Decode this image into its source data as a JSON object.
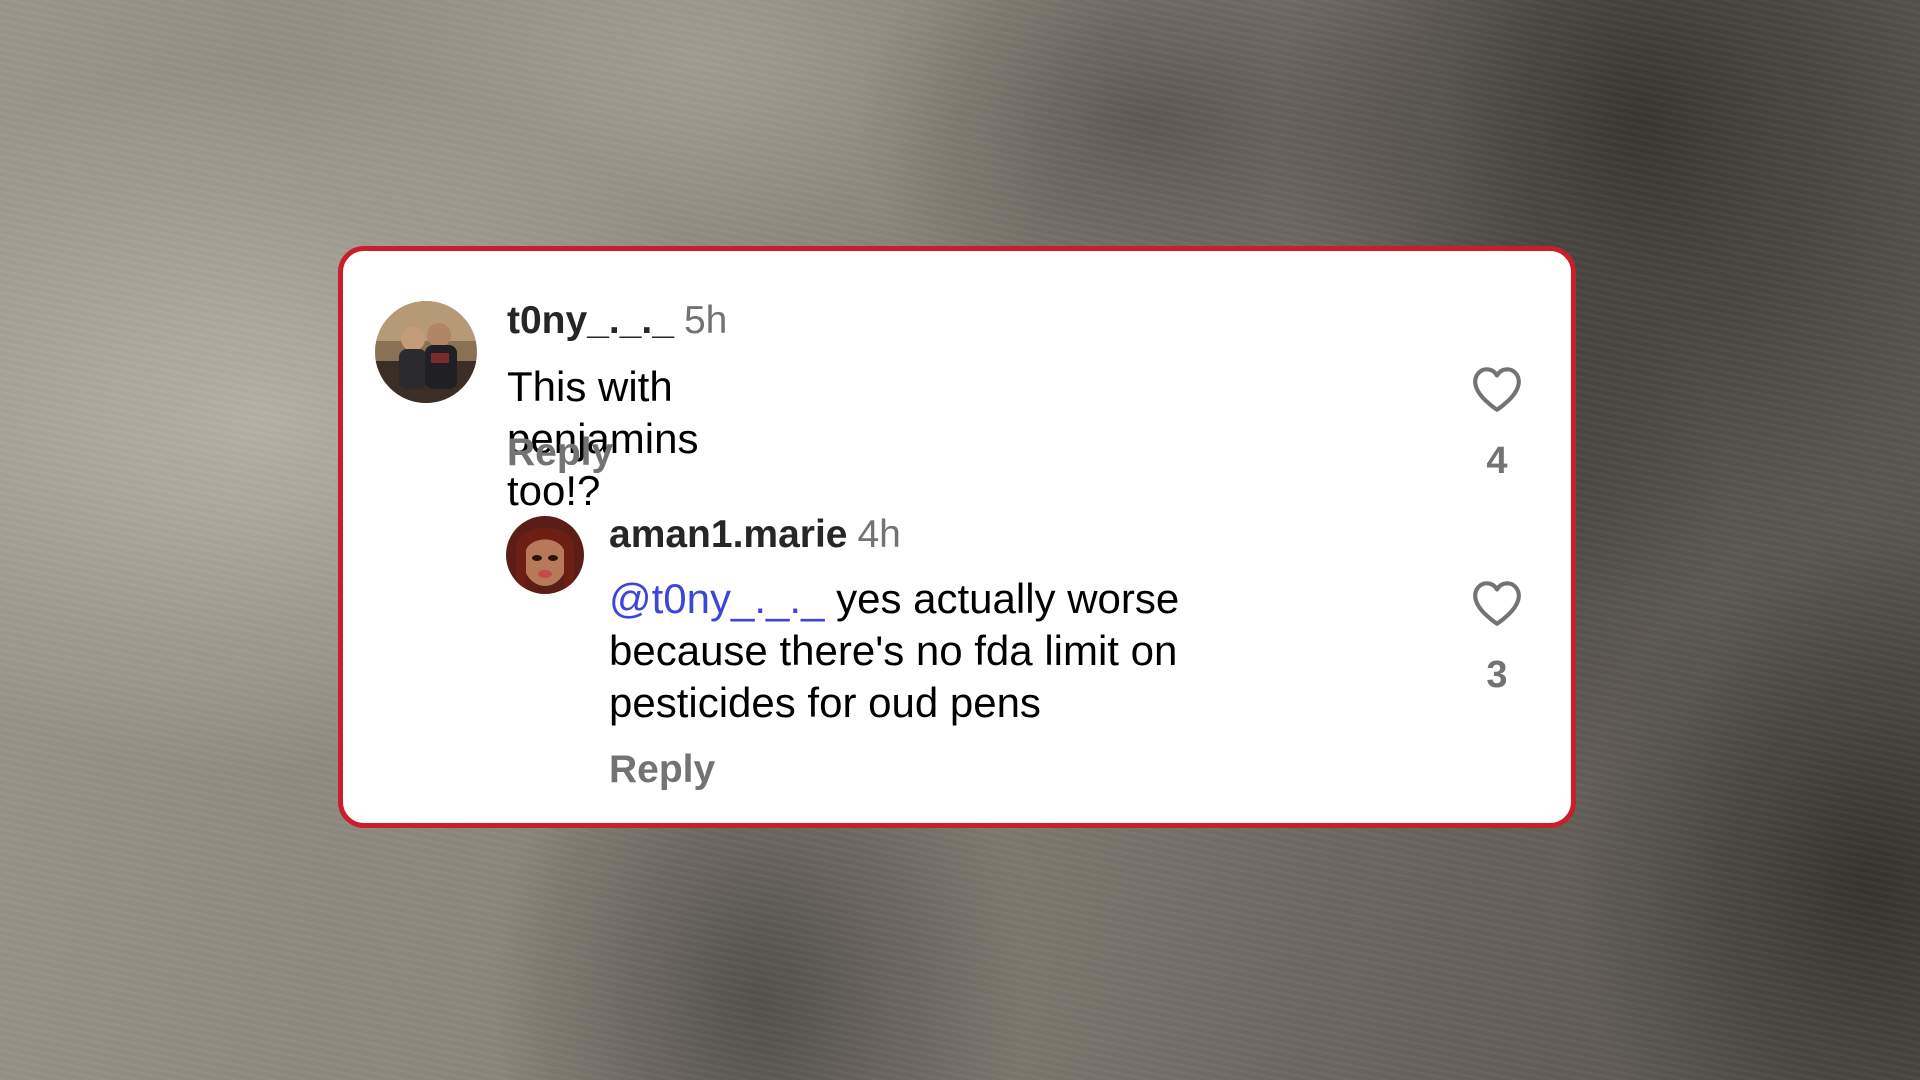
{
  "comments": [
    {
      "username": "t0ny_._._",
      "time": "5h",
      "text": "This with penjamins too!?",
      "reply_label": "Reply",
      "likes": "4",
      "avatar_icon": "profile-photo"
    }
  ],
  "reply": {
    "username": "aman1.marie",
    "time": "4h",
    "mention": "@t0ny_._._",
    "text_line1": " yes actually worse",
    "text_line2": "because there's no fda limit on",
    "text_line3": "pesticides for oud pens",
    "reply_label": "Reply",
    "likes": "3",
    "avatar_icon": "profile-photo"
  },
  "colors": {
    "frame_border": "#c8202a",
    "mention": "#3d46d8",
    "secondary_text": "#737373"
  }
}
